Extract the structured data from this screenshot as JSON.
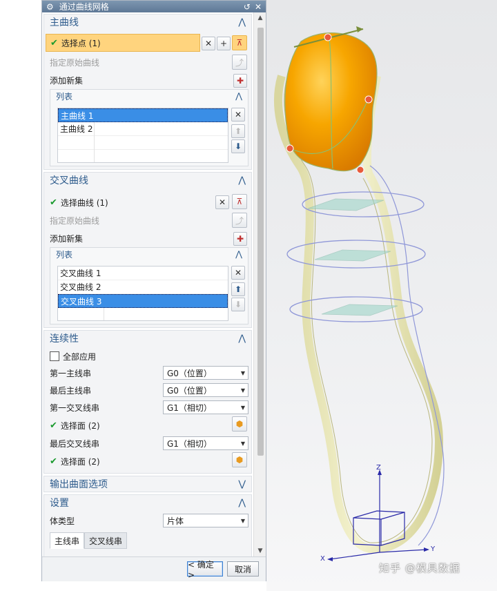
{
  "dialog": {
    "title": "通过曲线网格",
    "title_icon": "gear-icon",
    "reset_icon": "reset-icon",
    "close_icon": "close-icon"
  },
  "primary": {
    "header": "主曲线",
    "select_point_label": "选择点 (1)",
    "specify_original_label": "指定原始曲线",
    "add_new_set_label": "添加新集",
    "list_header": "列表",
    "items": [
      "主曲线 1",
      "主曲线 2"
    ],
    "selected_index": 0
  },
  "cross": {
    "header": "交叉曲线",
    "select_curve_label": "选择曲线 (1)",
    "specify_original_label": "指定原始曲线",
    "add_new_set_label": "添加新集",
    "list_header": "列表",
    "items": [
      "交叉曲线 1",
      "交叉曲线 2",
      "交叉曲线 3"
    ],
    "selected_index": 2
  },
  "continuity": {
    "header": "连续性",
    "apply_all_label": "全部应用",
    "apply_all_checked": false,
    "first_primary_label": "第一主线串",
    "first_primary_value": "G0（位置）",
    "last_primary_label": "最后主线串",
    "last_primary_value": "G0（位置）",
    "first_cross_label": "第一交叉线串",
    "first_cross_value": "G1（相切）",
    "select_face_1_label": "选择面 (2)",
    "last_cross_label": "最后交叉线串",
    "last_cross_value": "G1（相切）",
    "select_face_2_label": "选择面 (2)"
  },
  "output": {
    "header": "输出曲面选项"
  },
  "settings": {
    "header": "设置",
    "body_type_label": "体类型",
    "body_type_value": "片体",
    "tabs": [
      "主线串",
      "交叉线串"
    ],
    "active_tab": 0
  },
  "footer": {
    "ok_label": "< 确定 >",
    "cancel_label": "取消"
  },
  "viewport": {
    "watermark": "知乎 @模具数据",
    "axes": {
      "x": "X",
      "y": "Y",
      "z": "Z"
    },
    "colors": {
      "surface": "#f5a300",
      "ribbon": "#e9e7b4",
      "curve": "#8f97d8",
      "handle": "#d83a2a"
    }
  }
}
